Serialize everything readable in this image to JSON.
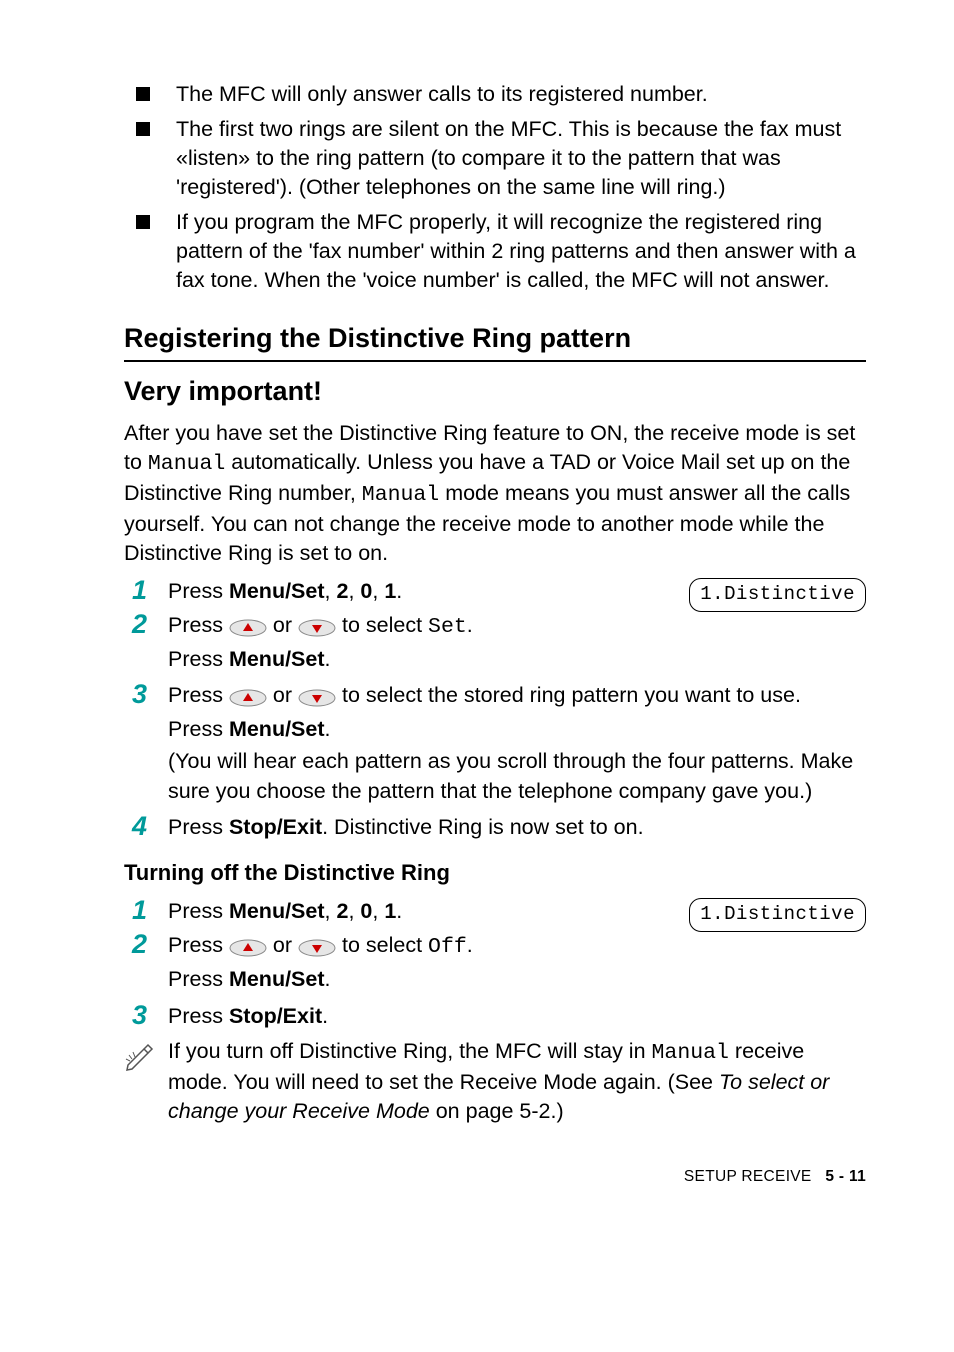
{
  "bullets": [
    "The MFC will only answer calls to its registered number.",
    "The first two rings are silent on the MFC. This is because the fax must «listen» to the ring pattern (to compare it to the pattern that was 'registered'). (Other telephones on the same line will ring.)",
    "If you program the MFC properly, it will recognize the registered ring pattern of the 'fax number' within 2 ring patterns and then answer with a fax tone. When the 'voice number' is called, the MFC will not answer."
  ],
  "section_heading": "Registering the Distinctive Ring pattern",
  "sub_heading": "Very important!",
  "intro_para": {
    "p1a": "After you have set the Distinctive Ring feature to ON, the receive mode is set to ",
    "p1b": "Manual",
    "p1c": " automatically. Unless you have a TAD or Voice Mail set up on the Distinctive Ring number, ",
    "p1d": "Manual",
    "p1e": " mode means you must answer all the calls yourself. You can not change the receive mode to another mode while the Distinctive Ring is set to on."
  },
  "reg_steps": {
    "s1": {
      "num": "1",
      "press": "Press ",
      "menu_set": "Menu/Set",
      "rest": ", ",
      "k1": "2",
      "c1": ", ",
      "k2": "0",
      "c2": ", ",
      "k3": "1",
      "dot": "."
    },
    "lcd1": "1.Distinctive",
    "s2": {
      "num": "2",
      "press": "Press ",
      "or": " or ",
      "to_select": " to select ",
      "set": "Set",
      "dot": ".",
      "press2": "Press ",
      "menu_set": "Menu/Set",
      "dot2": "."
    },
    "s3": {
      "num": "3",
      "press": "Press ",
      "or": " or ",
      "rest": " to select the stored ring pattern you want to use.",
      "press2": "Press ",
      "menu_set": "Menu/Set",
      "dot": ".",
      "paren": "(You will hear each pattern as you scroll through the four patterns. Make sure you choose the pattern that the telephone company gave you.)"
    },
    "s4": {
      "num": "4",
      "press": "Press ",
      "stop_exit": "Stop/Exit",
      "rest": ". Distinctive Ring is now set to on."
    }
  },
  "minor_heading": "Turning off the Distinctive Ring",
  "off_steps": {
    "s1": {
      "num": "1",
      "press": "Press ",
      "menu_set": "Menu/Set",
      "rest": ", ",
      "k1": "2",
      "c1": ", ",
      "k2": "0",
      "c2": ", ",
      "k3": "1",
      "dot": "."
    },
    "lcd2": "1.Distinctive",
    "s2": {
      "num": "2",
      "press": "Press ",
      "or": " or ",
      "to_select": " to select ",
      "off": "Off",
      "dot": ".",
      "press2": "Press ",
      "menu_set": "Menu/Set",
      "dot2": "."
    },
    "s3": {
      "num": "3",
      "press": "Press ",
      "stop_exit": "Stop/Exit",
      "dot": "."
    }
  },
  "note": {
    "a": "If you turn off Distinctive Ring, the MFC will stay in ",
    "manual": "Manual",
    "b": " receive mode. You will need to set the Receive Mode again. (See ",
    "link": "To select or change your Receive Mode",
    "c": " on page 5-2.)"
  },
  "footer": {
    "label": "SETUP RECEIVE",
    "page": "5 - 11"
  }
}
